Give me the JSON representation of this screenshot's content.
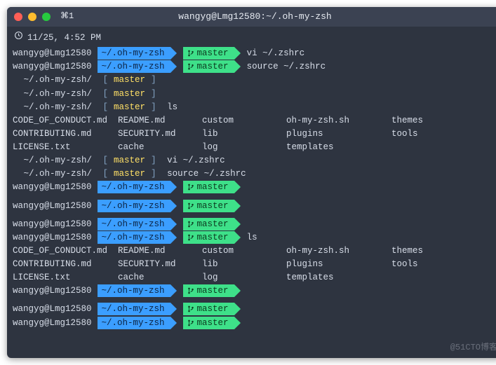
{
  "titlebar": {
    "hint": "⌘1",
    "title": "wangyg@Lmg12580:~/.oh-my-zsh"
  },
  "clock": "11/25, 4:52 PM",
  "host": "wangyg@Lmg12580",
  "seg": {
    "path": "~/.oh-my-zsh",
    "branch": "master"
  },
  "cmds": {
    "vi": "vi ~/.zshrc",
    "src": "source ~/.zshrc",
    "ls": "ls",
    "pvi": " vi ~/.zshrc",
    "psrc": " source ~/.zshrc",
    "pls": " ls"
  },
  "plain": {
    "apple": "",
    "path": " ~/.oh-my-zsh/",
    "lb": " [",
    "rb": "]",
    "branch": "master"
  },
  "ls_rows": [
    [
      "CODE_OF_CONDUCT.md",
      "README.md",
      "custom",
      "oh-my-zsh.sh",
      "themes"
    ],
    [
      "CONTRIBUTING.md",
      "SECURITY.md",
      "lib",
      "plugins",
      "tools"
    ],
    [
      "LICENSE.txt",
      "cache",
      "log",
      "templates",
      ""
    ]
  ],
  "watermark": "@51CTO博客"
}
